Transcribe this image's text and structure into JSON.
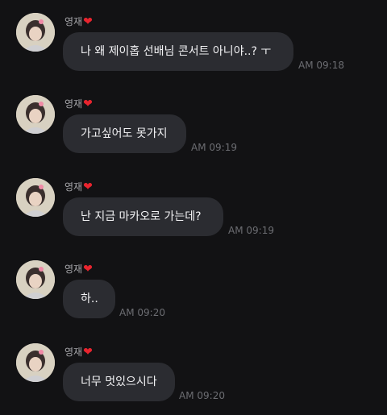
{
  "messages": [
    {
      "sender": "영재",
      "text": "나 왜 제이홉 선배님 콘서트 아니야..? ㅜ",
      "time": "AM 09:18"
    },
    {
      "sender": "영재",
      "text": "가고싶어도 못가지",
      "time": "AM 09:19"
    },
    {
      "sender": "영재",
      "text": "난 지금 마카오로 가는데?",
      "time": "AM 09:19"
    },
    {
      "sender": "영재",
      "text": "하..",
      "time": "AM 09:20"
    },
    {
      "sender": "영재",
      "text": "너무 멋있으시다",
      "time": "AM 09:20"
    }
  ],
  "heart_icon": "heart-icon",
  "colors": {
    "background": "#121214",
    "bubble": "#2b2c31",
    "heart": "#e8242e"
  }
}
